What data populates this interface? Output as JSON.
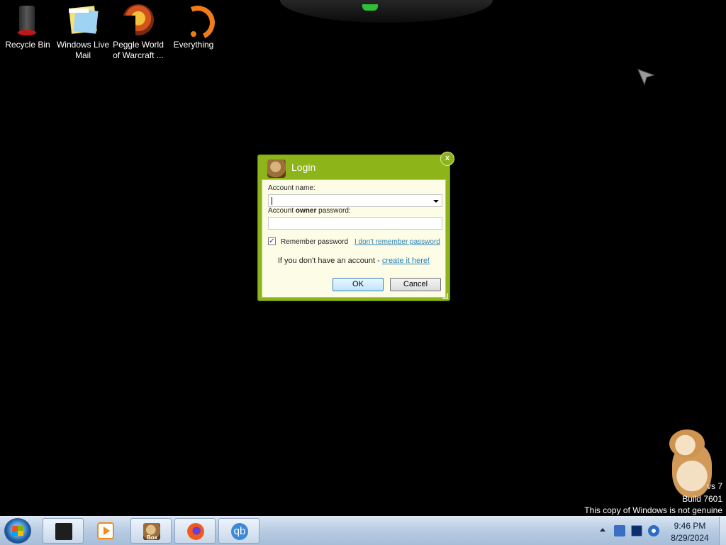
{
  "desktop": {
    "icons": [
      {
        "label": "Recycle Bin",
        "icon": "recycle-bin-icon"
      },
      {
        "label": "Windows Live Mail",
        "icon": "mail-icon"
      },
      {
        "label": "Peggle World of Warcraft ...",
        "icon": "peggle-icon"
      },
      {
        "label": "Everything",
        "icon": "everything-icon"
      }
    ]
  },
  "login_dialog": {
    "title": "Login",
    "close_label": "x",
    "account_name_label": "Account name:",
    "account_name_value": "",
    "password_label_pre": "Account ",
    "password_label_bold": "owner",
    "password_label_post": " password:",
    "password_value": "",
    "remember_checked": true,
    "remember_check_glyph": "✓",
    "remember_label": "Remember password",
    "forgot_link": "I don't remember password",
    "no_account_text": "If you don't have an account - ",
    "create_link": "create it here!",
    "ok_label": "OK",
    "cancel_label": "Cancel"
  },
  "watermark": {
    "line1": "vs 7",
    "line2": "Build 7601",
    "line3": "This copy of Windows is not genuine"
  },
  "taskbar": {
    "start_icon": "windows-start-icon",
    "apps": [
      {
        "name": "terminal-app",
        "icon": "black-window-icon",
        "active": true
      },
      {
        "name": "media-player-app",
        "icon": "media-player-icon",
        "active": false
      },
      {
        "name": "hamster-box-app",
        "icon": "hamster-box-icon",
        "active": true,
        "badge": "Box"
      },
      {
        "name": "firefox-app",
        "icon": "firefox-icon",
        "active": true
      },
      {
        "name": "qbittorrent-app",
        "icon": "qbittorrent-icon",
        "active": true,
        "text": "qb"
      }
    ],
    "tray": {
      "icons": [
        "show-hidden-icons-arrow",
        "book-icon",
        "monitor-icon",
        "network-icon"
      ],
      "time": "9:46 PM",
      "date": "8/29/2024"
    }
  },
  "colors": {
    "dialog_green": "#8db419",
    "dialog_body": "#fdfce6",
    "link": "#2a82b5",
    "taskbar": "#b7cbe2"
  }
}
